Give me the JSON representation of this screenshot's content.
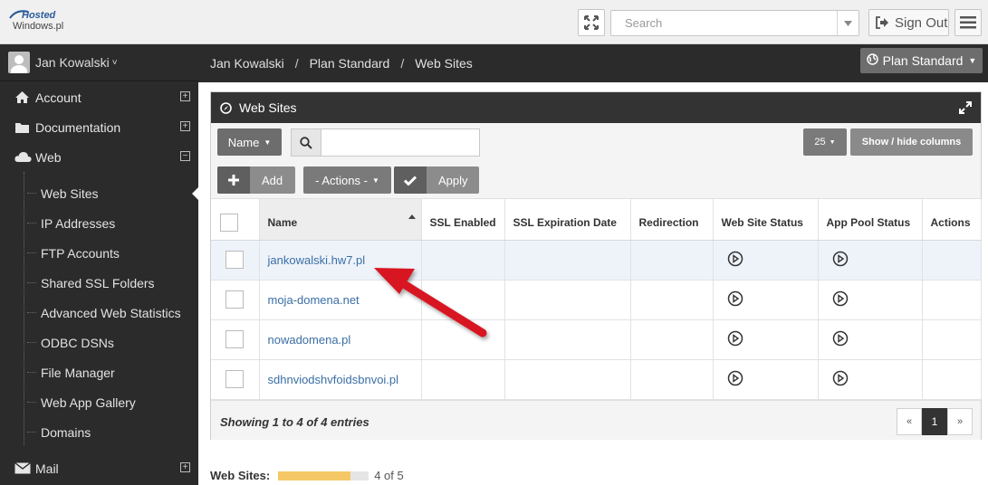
{
  "header": {
    "logo_top": "Hosted",
    "logo_bottom": "Windows.pl",
    "search_placeholder": "Search",
    "signout_label": "Sign Out"
  },
  "sidebar": {
    "user_name": "Jan Kowalski",
    "items": [
      {
        "label": "Account",
        "icon": "home-icon",
        "toggle": "+"
      },
      {
        "label": "Documentation",
        "icon": "folder-icon",
        "toggle": "+"
      },
      {
        "label": "Web",
        "icon": "cloud-icon",
        "toggle": "−"
      },
      {
        "label": "Mail",
        "icon": "envelope-icon",
        "toggle": "+"
      }
    ],
    "web_subitems": [
      {
        "label": "Web Sites",
        "active": true
      },
      {
        "label": "IP Addresses"
      },
      {
        "label": "FTP Accounts"
      },
      {
        "label": "Shared SSL Folders"
      },
      {
        "label": "Advanced Web Statistics"
      },
      {
        "label": "ODBC DSNs"
      },
      {
        "label": "File Manager"
      },
      {
        "label": "Web App Gallery"
      },
      {
        "label": "Domains"
      }
    ]
  },
  "breadcrumb": [
    "Jan Kowalski",
    "Plan Standard",
    "Web Sites"
  ],
  "plan_button": "Plan Standard",
  "panel": {
    "title": "Web Sites",
    "filter_field": "Name",
    "search_value": "",
    "page_size": "25",
    "show_hide_columns": "Show / hide columns",
    "add_label": "Add",
    "actions_label": "- Actions -",
    "apply_label": "Apply"
  },
  "table": {
    "columns": [
      "Name",
      "SSL Enabled",
      "SSL Expiration Date",
      "Redirection",
      "Web Site Status",
      "App Pool Status",
      "Actions"
    ],
    "rows": [
      {
        "name": "jankowalski.hw7.pl"
      },
      {
        "name": "moja-domena.net"
      },
      {
        "name": "nowadomena.pl"
      },
      {
        "name": "sdhnviodshvfoidsbnvoi.pl"
      }
    ]
  },
  "footer": {
    "entries_text": "Showing 1 to 4 of 4 entries",
    "prev": "«",
    "page": "1",
    "next": "»"
  },
  "quota": {
    "label": "Web Sites:",
    "used": 4,
    "total": 5,
    "text": "4 of 5",
    "fraction": 0.8,
    "color": "#f5c867"
  },
  "annotation_color": "#d71920"
}
